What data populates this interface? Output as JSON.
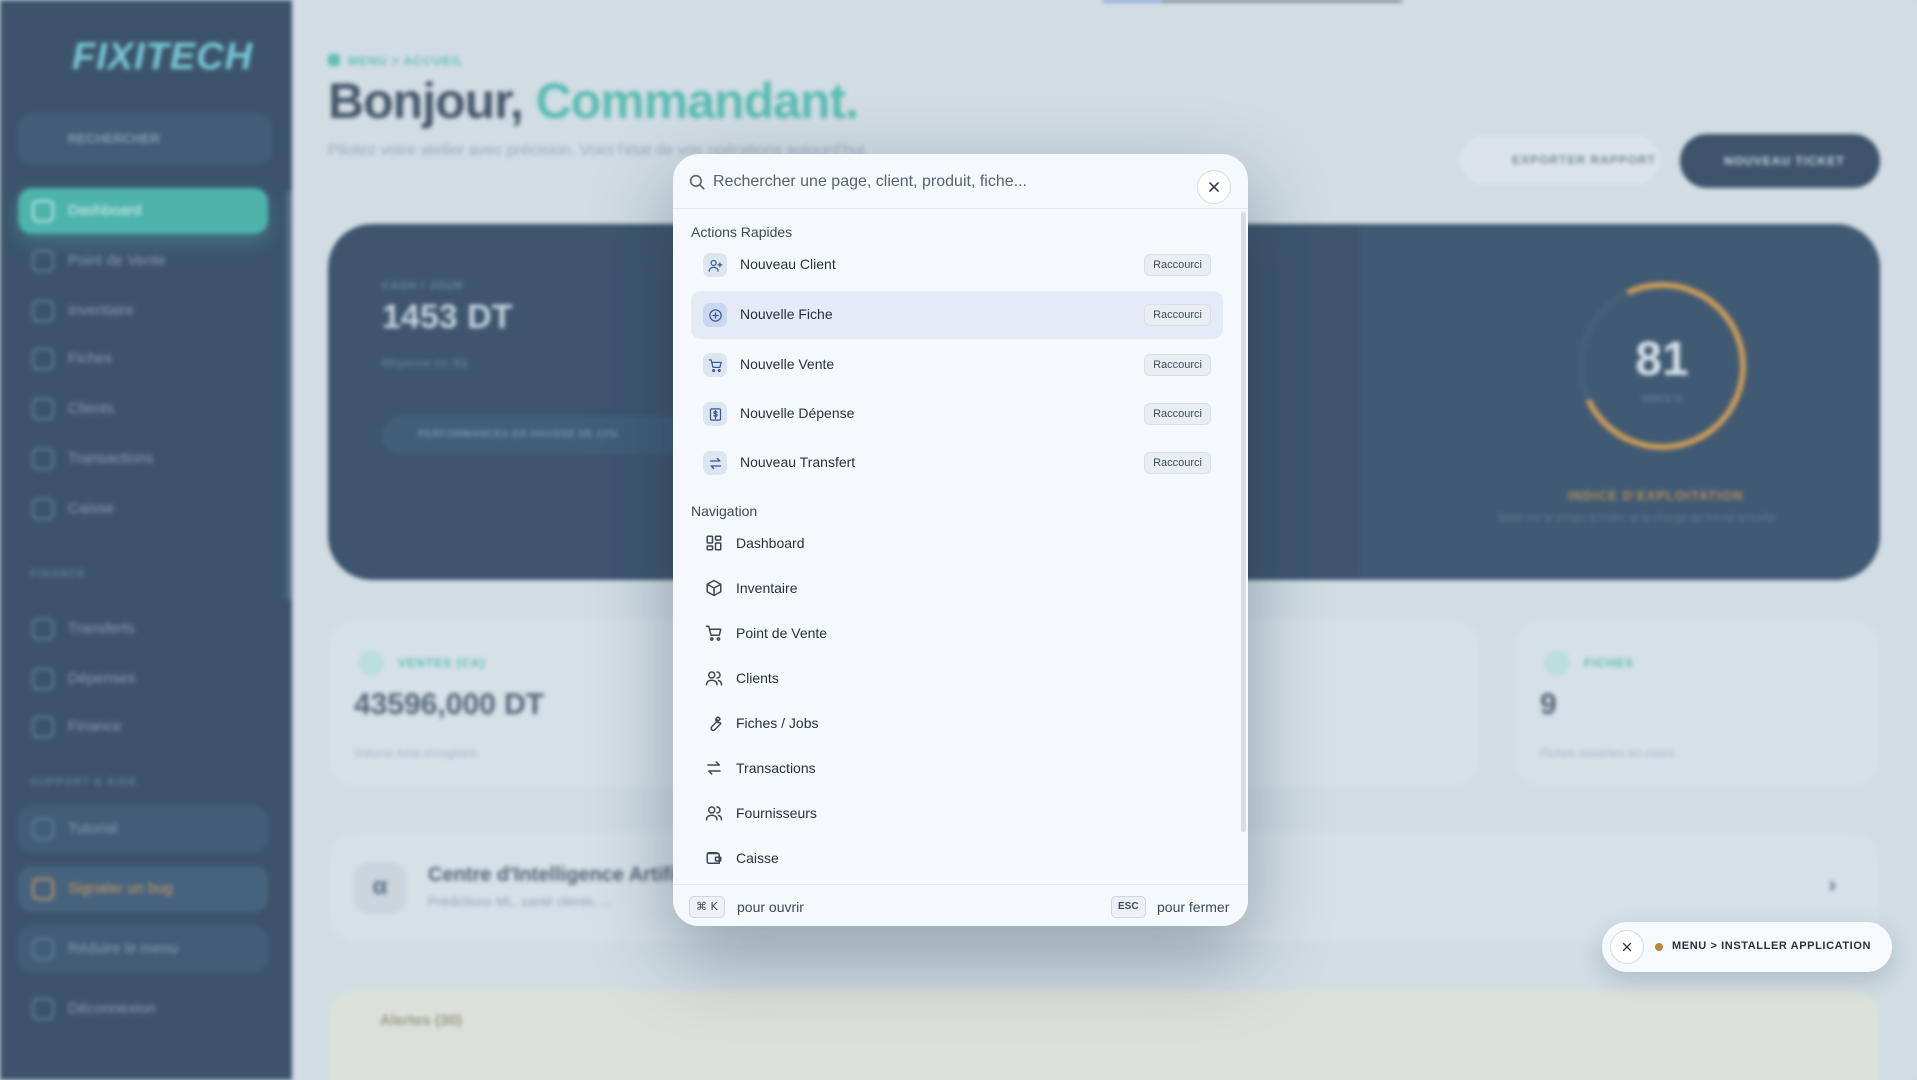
{
  "app": {
    "logo": "FIXITECH",
    "loading_progress": 0.2
  },
  "sidebar": {
    "search_label": "RECHERCHER",
    "items": [
      {
        "label": "Dashboard",
        "active": true
      },
      {
        "label": "Point de Vente"
      },
      {
        "label": "Inventaire"
      },
      {
        "label": "Fiches"
      },
      {
        "label": "Clients"
      },
      {
        "label": "Transactions"
      },
      {
        "label": "Caisse"
      }
    ],
    "section_finance": "FINANCE",
    "finance_items": [
      {
        "label": "Transferts"
      },
      {
        "label": "Dépenses"
      },
      {
        "label": "Finance"
      }
    ],
    "section_support": "SUPPORT & AIDE",
    "tutorial": "Tutorial",
    "bug": "Signaler un bug",
    "collapse": "Réduire le menu",
    "logout": "Déconnexion"
  },
  "header": {
    "breadcrumb": "MENU > ACCUEIL",
    "greeting": "Bonjour,",
    "greeting_name": "Commandant.",
    "subtitle": "Pilotez votre atelier avec précision. Voici l'état de vos opérations aujourd'hui.",
    "export_label": "EXPORTER RAPPORT",
    "new_ticket_label": "NOUVEAU TICKET"
  },
  "hero": {
    "label": "CASH / JOUR",
    "value": "1453 DT",
    "sub": "Moyenne en 30j",
    "pill": "PERFORMANCES EN HAUSSE DE 12%",
    "gauge_value": "81",
    "gauge_unit": "INDICE %",
    "gauge_title": "INDICE D'EXPLOITATION",
    "gauge_sub": "Basé sur le temps à traiter et la charge de travail actuelle"
  },
  "cards": [
    {
      "label": "VENTES (CA)",
      "value": "43596,000 DT",
      "sub": "Volume total enregistré"
    },
    {
      "label": "FICHES",
      "value": "9",
      "sub": "Fiches ouvertes en cours"
    }
  ],
  "ai": {
    "title": "Centre d'Intelligence Artificielle",
    "sub": "Prédictions ML, santé clients, ...",
    "logo": "α"
  },
  "alerts": {
    "title": "Alertes (30)"
  },
  "palette": {
    "placeholder": "Rechercher une page, client, produit, fiche...",
    "quick_title": "Actions Rapides",
    "shortcut_label": "Raccourci",
    "quick_actions": [
      {
        "label": "Nouveau Client",
        "icon": "user-plus-icon"
      },
      {
        "label": "Nouvelle Fiche",
        "icon": "plus-circle-icon"
      },
      {
        "label": "Nouvelle Vente",
        "icon": "cart-icon"
      },
      {
        "label": "Nouvelle Dépense",
        "icon": "dollar-receipt-icon"
      },
      {
        "label": "Nouveau Transfert",
        "icon": "arrows-swap-icon"
      }
    ],
    "nav_title": "Navigation",
    "nav_items": [
      {
        "label": "Dashboard",
        "icon": "grid-icon"
      },
      {
        "label": "Inventaire",
        "icon": "box-icon"
      },
      {
        "label": "Point de Vente",
        "icon": "cart-icon"
      },
      {
        "label": "Clients",
        "icon": "users-icon"
      },
      {
        "label": "Fiches / Jobs",
        "icon": "wrench-icon"
      },
      {
        "label": "Transactions",
        "icon": "arrows-swap-icon"
      },
      {
        "label": "Fournisseurs",
        "icon": "users-icon"
      },
      {
        "label": "Caisse",
        "icon": "wallet-icon"
      }
    ],
    "footer_open_key": "⌘ K",
    "footer_open_text": "pour ouvrir",
    "footer_close_key": "ESC",
    "footer_close_text": "pour fermer"
  },
  "toast": {
    "label": "MENU > INSTALLER APPLICATION"
  }
}
